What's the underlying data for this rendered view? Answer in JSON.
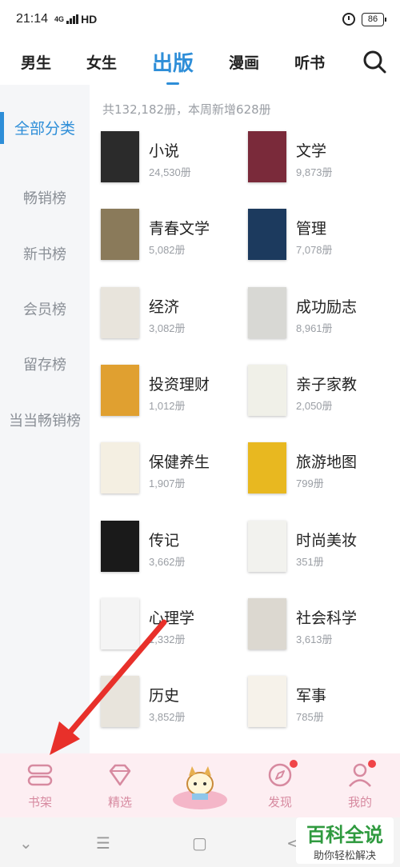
{
  "status": {
    "time": "21:14",
    "network": "4G",
    "hd": "HD",
    "battery": "86"
  },
  "top_tabs": [
    {
      "label": "男生"
    },
    {
      "label": "女生"
    },
    {
      "label": "出版",
      "active": true
    },
    {
      "label": "漫画"
    },
    {
      "label": "听书"
    }
  ],
  "sidebar": {
    "items": [
      {
        "label": "全部分类",
        "active": true
      },
      {
        "label": "畅销榜"
      },
      {
        "label": "新书榜"
      },
      {
        "label": "会员榜"
      },
      {
        "label": "留存榜"
      },
      {
        "label": "当当畅销榜"
      }
    ]
  },
  "summary": "共132,182册，本周新增628册",
  "categories": [
    {
      "name": "小说",
      "count": "24,530册",
      "cover_color": "#2b2b2b"
    },
    {
      "name": "文学",
      "count": "9,873册",
      "cover_color": "#7a2a3a"
    },
    {
      "name": "青春文学",
      "count": "5,082册",
      "cover_color": "#8a7a5a"
    },
    {
      "name": "管理",
      "count": "7,078册",
      "cover_color": "#1c3a5e"
    },
    {
      "name": "经济",
      "count": "3,082册",
      "cover_color": "#e8e4dc"
    },
    {
      "name": "成功励志",
      "count": "8,961册",
      "cover_color": "#d8d8d4"
    },
    {
      "name": "投资理财",
      "count": "1,012册",
      "cover_color": "#e0a030"
    },
    {
      "name": "亲子家教",
      "count": "2,050册",
      "cover_color": "#f0f0e8"
    },
    {
      "name": "保健养生",
      "count": "1,907册",
      "cover_color": "#f4efe2"
    },
    {
      "name": "旅游地图",
      "count": "799册",
      "cover_color": "#e8b820"
    },
    {
      "name": "传记",
      "count": "3,662册",
      "cover_color": "#1a1a1a"
    },
    {
      "name": "时尚美妆",
      "count": "351册",
      "cover_color": "#f2f2ee"
    },
    {
      "name": "心理学",
      "count": "1,332册",
      "cover_color": "#f4f4f4"
    },
    {
      "name": "社会科学",
      "count": "3,613册",
      "cover_color": "#dcd8d0"
    },
    {
      "name": "历史",
      "count": "3,852册",
      "cover_color": "#e8e4dc"
    },
    {
      "name": "军事",
      "count": "785册",
      "cover_color": "#f6f2ea"
    }
  ],
  "bottom_nav": [
    {
      "label": "书架",
      "icon": "bookshelf-icon"
    },
    {
      "label": "精选",
      "icon": "diamond-icon"
    },
    {
      "label": "",
      "icon": "mascot-icon"
    },
    {
      "label": "发现",
      "icon": "compass-icon",
      "badge": true
    },
    {
      "label": "我的",
      "icon": "user-icon",
      "badge": true
    }
  ],
  "watermark": {
    "main": "百科全说",
    "sub": "助你轻松解决"
  },
  "colors": {
    "accent": "#2e8ed8",
    "nav_bg": "#fdeef2",
    "nav_text": "#d78aa0",
    "badge": "#f04448",
    "arrow": "#e8302a"
  }
}
